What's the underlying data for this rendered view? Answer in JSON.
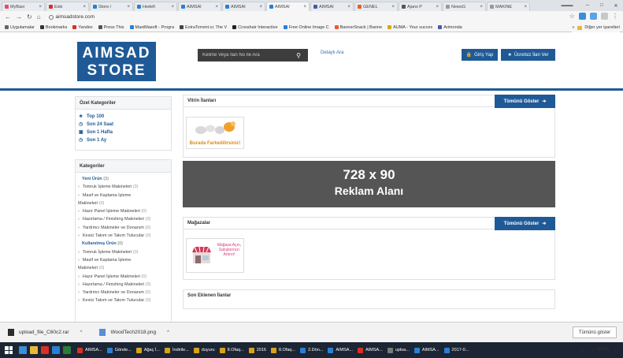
{
  "browser": {
    "tabs": [
      {
        "label": "MyBasi",
        "color": "#e04d6b",
        "active": false
      },
      {
        "label": "Eski",
        "color": "#d93025",
        "active": false
      },
      {
        "label": "Store /",
        "color": "#2a7fd4",
        "active": false
      },
      {
        "label": "Hedefi",
        "color": "#2a7fd4",
        "active": false
      },
      {
        "label": "AIMSAI",
        "color": "#2a7fd4",
        "active": false
      },
      {
        "label": "AIMSAI",
        "color": "#2a7fd4",
        "active": false
      },
      {
        "label": "AIMSAI",
        "color": "#2a7fd4",
        "active": true
      },
      {
        "label": "AIMSAI",
        "color": "#4a5aa8",
        "active": false
      },
      {
        "label": "GENEL",
        "color": "#e85c2a",
        "active": false
      },
      {
        "label": "Ajans P",
        "color": "#555555",
        "active": false
      },
      {
        "label": "NewsG",
        "color": "#999999",
        "active": false
      },
      {
        "label": "MAKİNE",
        "color": "#999999",
        "active": false
      }
    ],
    "url": "aimsadstore.com",
    "bookmarks": [
      {
        "label": "Uygulamalar",
        "color": "#666666"
      },
      {
        "label": "Bookmarks",
        "color": "#333333"
      },
      {
        "label": "Yandex",
        "color": "#d93025"
      },
      {
        "label": "Press This",
        "color": "#555555"
      },
      {
        "label": "MaxiMasoft - Progra",
        "color": "#2a7fd4"
      },
      {
        "label": "ExtraTorrent.cc The V",
        "color": "#444444"
      },
      {
        "label": "Crosshair Interactive",
        "color": "#222222"
      },
      {
        "label": "Free Online Image C",
        "color": "#2a7fd4"
      },
      {
        "label": "BannerSnack | Banne",
        "color": "#e85c2a"
      },
      {
        "label": "AUMA - Your succes",
        "color": "#d9a21b"
      },
      {
        "label": "Arimonda",
        "color": "#4a5aa8"
      }
    ],
    "other_bookmarks": "Diğer yer işaretleri"
  },
  "site": {
    "logo_line1": "AIMSAD",
    "logo_line2": "STORE",
    "search_placeholder": "Kelime Veya İlan No İle Ara",
    "detayli": "Detaylı Ara",
    "login": "Giriş Yap",
    "free_ad": "Ücretsiz İlan Ver"
  },
  "sidebar": {
    "ozel_title": "Özel Kategoriler",
    "ozel_items": [
      {
        "icon": "★",
        "label": "Top 100"
      },
      {
        "icon": "◷",
        "label": "Son 24 Saat"
      },
      {
        "icon": "▣",
        "label": "Son 1 Hafta"
      },
      {
        "icon": "◷",
        "label": "Son 1 Ay"
      }
    ],
    "kategoriler_title": "Kategoriler",
    "kategoriler": [
      {
        "type": "head",
        "label": "Yeni Ürün",
        "count": "(3)"
      },
      {
        "type": "sub",
        "label": "Tomruk İşleme Makineleri",
        "count": "(3)"
      },
      {
        "type": "sub",
        "label": "Masif ve Kaplama İşleme",
        "count": ""
      },
      {
        "type": "plain",
        "label": "Makineleri",
        "count": "(0)"
      },
      {
        "type": "sub",
        "label": "Hazır Panel İşleme Makineleri",
        "count": "(0)"
      },
      {
        "type": "sub",
        "label": "Hazırlama / Finishing Makineleri",
        "count": "(0)"
      },
      {
        "type": "sub",
        "label": "Yardımcı Makineler ve Donanım",
        "count": "(0)"
      },
      {
        "type": "sub",
        "label": "Kesici Takım ve Takım Tutucular",
        "count": "(0)"
      },
      {
        "type": "head",
        "label": "Kullanılmış Ürün",
        "count": "(0)"
      },
      {
        "type": "sub",
        "label": "Tomruk İşleme Makineleri",
        "count": "(0)"
      },
      {
        "type": "sub",
        "label": "Masif ve Kaplama İşleme",
        "count": ""
      },
      {
        "type": "plain",
        "label": "Makineleri",
        "count": "(0)"
      },
      {
        "type": "sub",
        "label": "Hazır Panel İşleme Makineleri",
        "count": "(0)"
      },
      {
        "type": "sub",
        "label": "Hazırlama / Finishing Makineleri",
        "count": "(0)"
      },
      {
        "type": "sub",
        "label": "Yardımcı Makineler ve Donanım",
        "count": "(0)"
      },
      {
        "type": "sub",
        "label": "Kesici Takım ve Takım Tutucular",
        "count": "(0)"
      }
    ]
  },
  "main": {
    "vitrin_title": "Vitrin İlanları",
    "show_all": "Tümünü Göster",
    "vitrin_thumb_caption": "Burada Farkedilirsiniz!",
    "ad_size": "728 x 90",
    "ad_label": "Reklam Alanı",
    "magaza_title": "Mağazalar",
    "magaza_thumb_caption": "Mağaza Açın, Satışlarınızı Artırın!",
    "son_title": "Son Eklenen İlanlar"
  },
  "downloads": {
    "items": [
      {
        "name": "upload_file_C60c2.rar"
      },
      {
        "name": "WoodTech2018.png"
      }
    ],
    "show_all": "Tümünü göster"
  },
  "taskbar": {
    "items": [
      {
        "label": "AIMSA...",
        "color": "#d93025"
      },
      {
        "label": "Gönde...",
        "color": "#2a7fd4"
      },
      {
        "label": "Ağaç İ...",
        "color": "#d9a21b"
      },
      {
        "label": "İndirile...",
        "color": "#d9a21b"
      },
      {
        "label": "duyuru",
        "color": "#d9a21b"
      },
      {
        "label": "8.Ofaq...",
        "color": "#d9a21b"
      },
      {
        "label": "2016",
        "color": "#d9a21b"
      },
      {
        "label": "8.Ofaq...",
        "color": "#d9a21b"
      },
      {
        "label": "2.Dön...",
        "color": "#2a7fd4"
      },
      {
        "label": "AIMSA...",
        "color": "#2a7fd4"
      },
      {
        "label": "AIMSA...",
        "color": "#d93025"
      },
      {
        "label": "uploa...",
        "color": "#7a7a7a"
      },
      {
        "label": "AIMSA...",
        "color": "#2a7fd4"
      },
      {
        "label": "2017-0...",
        "color": "#2a7fd4"
      }
    ],
    "clock": "00:56"
  }
}
